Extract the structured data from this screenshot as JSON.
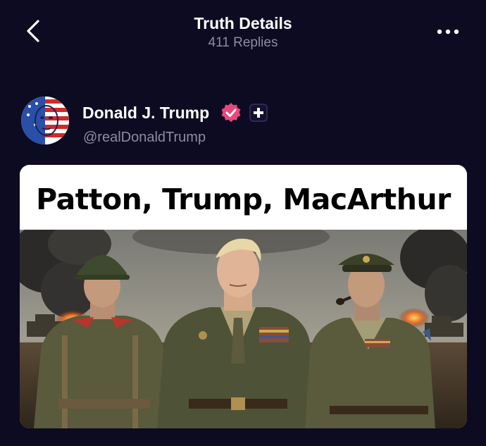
{
  "header": {
    "title": "Truth Details",
    "replies": "411 Replies",
    "back_icon": "chevron-left-icon",
    "more_icon": "more-dots-icon"
  },
  "post": {
    "author": {
      "name": "Donald J. Trump",
      "handle": "@realDonaldTrump",
      "verified_color": "#e8477b",
      "badges": [
        "verified-badge-icon",
        "plus-badge-icon"
      ]
    },
    "media": {
      "caption": "Patton, Trump, MacArthur"
    }
  },
  "colors": {
    "background": "#0d0b22",
    "primary_text": "#ffffff",
    "secondary_text": "#8d8aa3"
  }
}
